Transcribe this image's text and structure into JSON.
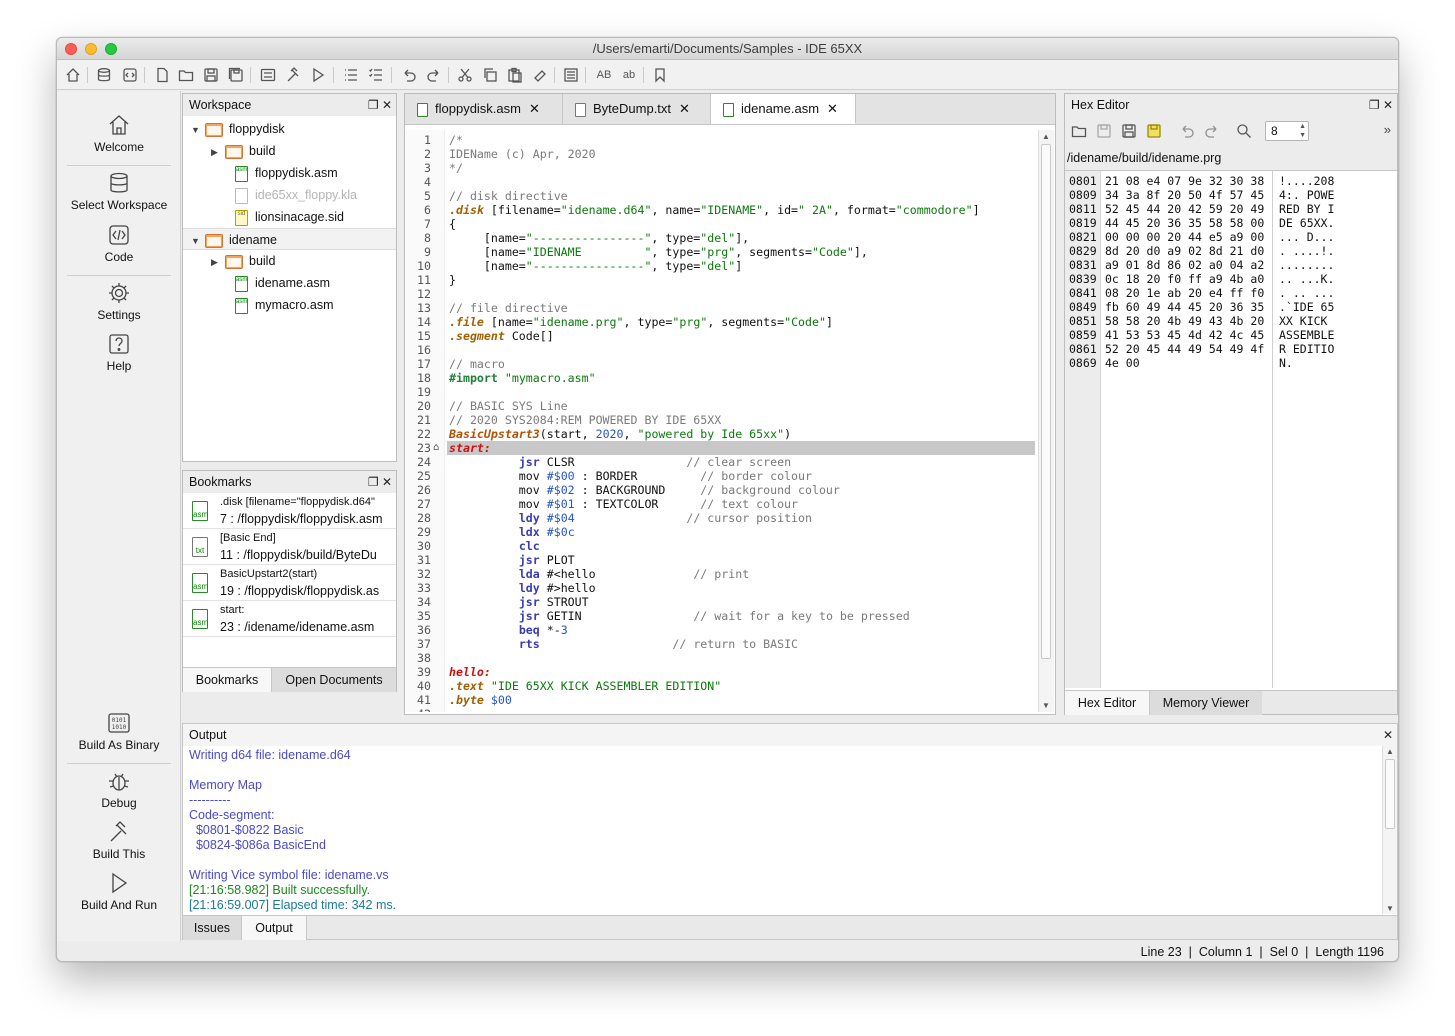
{
  "window": {
    "title": "/Users/emarti/Documents/Samples - IDE 65XX"
  },
  "sidebar": {
    "items": [
      {
        "label": "Welcome",
        "icon": "home-icon"
      },
      {
        "label": "Select Workspace",
        "icon": "database-icon"
      },
      {
        "label": "Code",
        "icon": "code-icon"
      },
      {
        "label": "Settings",
        "icon": "gear-icon"
      },
      {
        "label": "Help",
        "icon": "help-icon"
      }
    ],
    "build_items": [
      {
        "label": "Build As Binary",
        "icon": "binary-icon"
      },
      {
        "label": "Debug",
        "icon": "bug-icon"
      },
      {
        "label": "Build This",
        "icon": "hammer-icon"
      },
      {
        "label": "Build And Run",
        "icon": "play-icon"
      }
    ]
  },
  "workspace": {
    "title": "Workspace",
    "tree": [
      {
        "label": "floppydisk",
        "type": "folder",
        "expanded": true
      },
      {
        "label": "build",
        "type": "folder",
        "expanded": false
      },
      {
        "label": "floppydisk.asm",
        "type": "asm"
      },
      {
        "label": "ide65xx_floppy.kla",
        "type": "dim"
      },
      {
        "label": "lionsinacage.sid",
        "type": "sid"
      },
      {
        "label": "idename",
        "type": "folder",
        "expanded": true
      },
      {
        "label": "build",
        "type": "folder",
        "expanded": false
      },
      {
        "label": "idename.asm",
        "type": "asm"
      },
      {
        "label": "mymacro.asm",
        "type": "asm"
      }
    ]
  },
  "bookmarks": {
    "title": "Bookmarks",
    "items": [
      {
        "line1": ".disk [filename=\"floppydisk.d64\"",
        "line2": "7 : /floppydisk/floppydisk.asm",
        "type": "asm"
      },
      {
        "line1": "[Basic End]",
        "line2": "11 : /floppydisk/build/ByteDu",
        "type": "txt"
      },
      {
        "line1": "BasicUpstart2(start)",
        "line2": "19 : /floppydisk/floppydisk.as",
        "type": "asm"
      },
      {
        "line1": "start:",
        "line2": "23 : /idename/idename.asm",
        "type": "asm"
      }
    ],
    "tabs": [
      "Bookmarks",
      "Open Documents"
    ]
  },
  "editor": {
    "tabs": [
      "floppydisk.asm",
      "ByteDump.txt",
      "idename.asm"
    ],
    "active_tab": "idename.asm",
    "current_line": 23
  },
  "hex_editor": {
    "title": "Hex Editor",
    "path": "/idename/build/idename.prg",
    "bytes_per_row": "8",
    "rows": [
      {
        "addr": "0801",
        "hex": "21 08 e4 07 9e 32 30 38",
        "ascii": "!....208"
      },
      {
        "addr": "0809",
        "hex": "34 3a 8f 20 50 4f 57 45",
        "ascii": "4:. POWE"
      },
      {
        "addr": "0811",
        "hex": "52 45 44 20 42 59 20 49",
        "ascii": "RED BY I"
      },
      {
        "addr": "0819",
        "hex": "44 45 20 36 35 58 58 00",
        "ascii": "DE 65XX."
      },
      {
        "addr": "0821",
        "hex": "00 00 00 20 44 e5 a9 00",
        "ascii": "... D..."
      },
      {
        "addr": "0829",
        "hex": "8d 20 d0 a9 02 8d 21 d0",
        "ascii": ". ....!."
      },
      {
        "addr": "0831",
        "hex": "a9 01 8d 86 02 a0 04 a2",
        "ascii": "........"
      },
      {
        "addr": "0839",
        "hex": "0c 18 20 f0 ff a9 4b a0",
        "ascii": ".. ...K."
      },
      {
        "addr": "0841",
        "hex": "08 20 1e ab 20 e4 ff f0",
        "ascii": ". .. ..."
      },
      {
        "addr": "0849",
        "hex": "fb 60 49 44 45 20 36 35",
        "ascii": ".`IDE 65"
      },
      {
        "addr": "0851",
        "hex": "58 58 20 4b 49 43 4b 20",
        "ascii": "XX KICK "
      },
      {
        "addr": "0859",
        "hex": "41 53 53 45 4d 42 4c 45",
        "ascii": "ASSEMBLE"
      },
      {
        "addr": "0861",
        "hex": "52 20 45 44 49 54 49 4f",
        "ascii": "R EDITIO"
      },
      {
        "addr": "0869",
        "hex": "4e 00",
        "ascii": "N."
      }
    ],
    "tabs": [
      "Hex Editor",
      "Memory Viewer"
    ]
  },
  "output": {
    "title": "Output",
    "lines": [
      {
        "text": "Writing d64 file: idename.d64",
        "color": "#4a4ac8"
      },
      {
        "text": "",
        "color": "#4a4ac8"
      },
      {
        "text": "Memory Map",
        "color": "#4a4ac8"
      },
      {
        "text": "----------",
        "color": "#4a4ac8"
      },
      {
        "text": "Code-segment:",
        "color": "#4a4ac8"
      },
      {
        "text": "  $0801-$0822 Basic",
        "color": "#4a4ac8"
      },
      {
        "text": "  $0824-$086a BasicEnd",
        "color": "#4a4ac8"
      },
      {
        "text": "",
        "color": "#4a4ac8"
      },
      {
        "text": "Writing Vice symbol file: idename.vs",
        "color": "#4a4ac8"
      },
      {
        "text": "[21:16:58.982] Built successfully.",
        "color": "#1a8a1a"
      },
      {
        "text": "[21:16:59.007] Elapsed time: 342 ms.",
        "color": "#1a7a9a"
      }
    ],
    "tabs": [
      "Issues",
      "Output"
    ]
  },
  "status": {
    "line": "Line 23",
    "column": "Column 1",
    "sel": "Sel 0",
    "length": "Length 1196"
  },
  "code": [
    [
      [
        "/*",
        "com"
      ]
    ],
    [
      [
        "IDEName (c) Apr, 2020",
        "com"
      ]
    ],
    [
      [
        "*/",
        "com"
      ]
    ],
    [],
    [
      [
        "// disk directive",
        "com"
      ]
    ],
    [
      [
        ".disk",
        "dir"
      ],
      [
        " [filename=",
        ""
      ],
      [
        "\"idename.d64\"",
        "str"
      ],
      [
        ", name=",
        ""
      ],
      [
        "\"IDENAME\"",
        "str"
      ],
      [
        ", id=",
        ""
      ],
      [
        "\" 2A\"",
        "str"
      ],
      [
        ", format=",
        ""
      ],
      [
        "\"commodore\"",
        "str"
      ],
      [
        "]",
        ""
      ]
    ],
    [
      [
        "{",
        ""
      ]
    ],
    [
      [
        "     [name=",
        ""
      ],
      [
        "\"----------------\"",
        "str"
      ],
      [
        ", type=",
        ""
      ],
      [
        "\"del\"",
        "str"
      ],
      [
        "],",
        ""
      ]
    ],
    [
      [
        "     [name=",
        ""
      ],
      [
        "\"IDENAME         \"",
        "str"
      ],
      [
        ", type=",
        ""
      ],
      [
        "\"prg\"",
        "str"
      ],
      [
        ", segments=",
        ""
      ],
      [
        "\"Code\"",
        "str"
      ],
      [
        "],",
        ""
      ]
    ],
    [
      [
        "     [name=",
        ""
      ],
      [
        "\"----------------\"",
        "str"
      ],
      [
        ", type=",
        ""
      ],
      [
        "\"del\"",
        "str"
      ],
      [
        "]",
        ""
      ]
    ],
    [
      [
        "}",
        ""
      ]
    ],
    [],
    [
      [
        "// file directive",
        "com"
      ]
    ],
    [
      [
        ".file",
        "dir"
      ],
      [
        " [name=",
        ""
      ],
      [
        "\"idename.prg\"",
        "str"
      ],
      [
        ", type=",
        ""
      ],
      [
        "\"prg\"",
        "str"
      ],
      [
        ", segments=",
        ""
      ],
      [
        "\"Code\"",
        "str"
      ],
      [
        "]",
        ""
      ]
    ],
    [
      [
        ".segment",
        "dir"
      ],
      [
        " Code[]",
        ""
      ]
    ],
    [],
    [
      [
        "// macro",
        "com"
      ]
    ],
    [
      [
        "#import",
        "imp"
      ],
      [
        " ",
        ""
      ],
      [
        "\"mymacro.asm\"",
        "str"
      ]
    ],
    [],
    [
      [
        "// BASIC SYS Line",
        "com"
      ]
    ],
    [
      [
        "// 2020 SYS2084:REM POWERED BY IDE 65XX",
        "com"
      ]
    ],
    [
      [
        "BasicUpstart3",
        "mac"
      ],
      [
        "(start, ",
        ""
      ],
      [
        "2020",
        "num"
      ],
      [
        ", ",
        ""
      ],
      [
        "\"powered by Ide 65xx\"",
        "str"
      ],
      [
        ")",
        ""
      ]
    ],
    [
      [
        "start:",
        "lbl"
      ]
    ],
    [
      [
        "          ",
        ""
      ],
      [
        "jsr",
        "kw"
      ],
      [
        " CLSR                ",
        ""
      ],
      [
        "// clear screen",
        "com"
      ]
    ],
    [
      [
        "          mov ",
        ""
      ],
      [
        "#$00",
        "num"
      ],
      [
        " : BORDER         ",
        ""
      ],
      [
        "// border colour",
        "com"
      ]
    ],
    [
      [
        "          mov ",
        ""
      ],
      [
        "#$02",
        "num"
      ],
      [
        " : BACKGROUND     ",
        ""
      ],
      [
        "// background colour",
        "com"
      ]
    ],
    [
      [
        "          mov ",
        ""
      ],
      [
        "#$01",
        "num"
      ],
      [
        " : TEXTCOLOR      ",
        ""
      ],
      [
        "// text colour",
        "com"
      ]
    ],
    [
      [
        "          ",
        ""
      ],
      [
        "ldy",
        "kw"
      ],
      [
        " ",
        ""
      ],
      [
        "#$04",
        "num"
      ],
      [
        "                ",
        ""
      ],
      [
        "// cursor position",
        "com"
      ]
    ],
    [
      [
        "          ",
        ""
      ],
      [
        "ldx",
        "kw"
      ],
      [
        " ",
        ""
      ],
      [
        "#$0c",
        "num"
      ]
    ],
    [
      [
        "          ",
        ""
      ],
      [
        "clc",
        "kw"
      ]
    ],
    [
      [
        "          ",
        ""
      ],
      [
        "jsr",
        "kw"
      ],
      [
        " PLOT",
        ""
      ]
    ],
    [
      [
        "          ",
        ""
      ],
      [
        "lda",
        "kw"
      ],
      [
        " #<hello              ",
        ""
      ],
      [
        "// print",
        "com"
      ]
    ],
    [
      [
        "          ",
        ""
      ],
      [
        "ldy",
        "kw"
      ],
      [
        " #>hello",
        ""
      ]
    ],
    [
      [
        "          ",
        ""
      ],
      [
        "jsr",
        "kw"
      ],
      [
        " STROUT",
        ""
      ]
    ],
    [
      [
        "          ",
        ""
      ],
      [
        "jsr",
        "kw"
      ],
      [
        " GETIN                ",
        ""
      ],
      [
        "// wait for a key to be pressed",
        "com"
      ]
    ],
    [
      [
        "          ",
        ""
      ],
      [
        "beq",
        "kw"
      ],
      [
        " *-",
        ""
      ],
      [
        "3",
        "num"
      ]
    ],
    [
      [
        "          ",
        ""
      ],
      [
        "rts",
        "kw"
      ],
      [
        "                   ",
        ""
      ],
      [
        "// return to BASIC",
        "com"
      ]
    ],
    [],
    [
      [
        "hello:",
        "lbl"
      ]
    ],
    [
      [
        ".text",
        "dir"
      ],
      [
        " ",
        ""
      ],
      [
        "\"IDE 65XX KICK ASSEMBLER EDITION\"",
        "str"
      ]
    ],
    [
      [
        ".byte",
        "dir"
      ],
      [
        " ",
        ""
      ],
      [
        "$00",
        "num"
      ]
    ],
    []
  ],
  "colors": {
    "accent_folder": "#f5a45a",
    "current_line": "#c8c8c8",
    "label": "#d01010"
  }
}
